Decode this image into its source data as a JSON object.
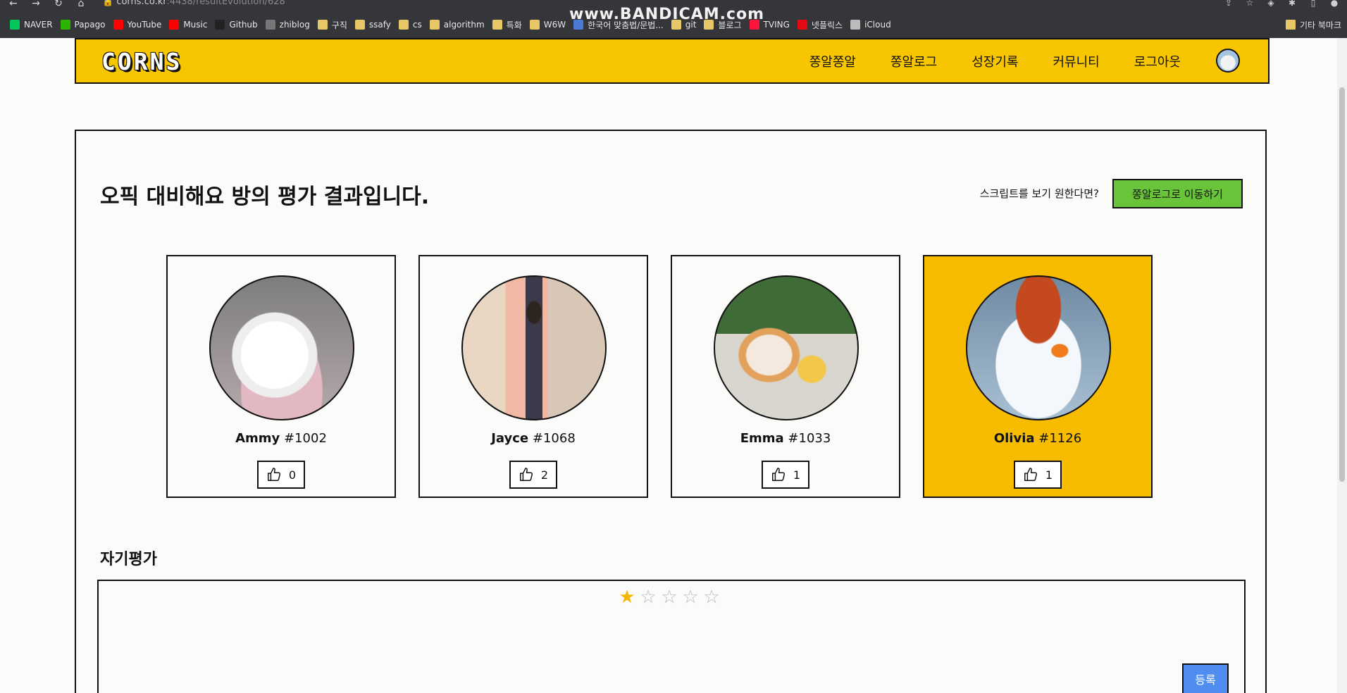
{
  "browser": {
    "url_host": "corns.co.kr",
    "url_rest": ":4438/resultEvolution/628",
    "watermark": "www.BANDICAM.com",
    "bookmarks": [
      {
        "label": "NAVER",
        "icon": "naver-icon",
        "color": "#03c75a"
      },
      {
        "label": "Papago",
        "icon": "papago-icon",
        "color": "#2db400"
      },
      {
        "label": "YouTube",
        "icon": "youtube-icon",
        "color": "#ff0000"
      },
      {
        "label": "Music",
        "icon": "music-icon",
        "color": "#ff0000"
      },
      {
        "label": "Github",
        "icon": "github-icon",
        "color": "#222222"
      },
      {
        "label": "zhiblog",
        "icon": "zhiblog-icon",
        "color": "#777777"
      },
      {
        "label": "구직",
        "icon": "folder-icon",
        "color": "#e8c766"
      },
      {
        "label": "ssafy",
        "icon": "folder-icon",
        "color": "#e8c766"
      },
      {
        "label": "cs",
        "icon": "folder-icon",
        "color": "#e8c766"
      },
      {
        "label": "algorithm",
        "icon": "folder-icon",
        "color": "#e8c766"
      },
      {
        "label": "특화",
        "icon": "folder-icon",
        "color": "#e8c766"
      },
      {
        "label": "W6W",
        "icon": "folder-icon",
        "color": "#e8c766"
      },
      {
        "label": "한국어 맞춤법/문법...",
        "icon": "spellcheck-icon",
        "color": "#4b7bd6"
      },
      {
        "label": "git",
        "icon": "folder-icon",
        "color": "#e8c766"
      },
      {
        "label": "블로그",
        "icon": "folder-icon",
        "color": "#e8c766"
      },
      {
        "label": "TVING",
        "icon": "tving-icon",
        "color": "#ff153c"
      },
      {
        "label": "넷플릭스",
        "icon": "netflix-icon",
        "color": "#e50914"
      },
      {
        "label": "iCloud",
        "icon": "apple-icon",
        "color": "#bbbbbb"
      }
    ],
    "other_bookmarks": "기타 북마크"
  },
  "header": {
    "logo": "CORNS",
    "nav": [
      "쫑알쫑알",
      "쫑알로그",
      "성장기록",
      "커뮤니티",
      "로그아웃"
    ],
    "accent_color": "#f7c600"
  },
  "main": {
    "title": "오픽 대비해요 방의 평가 결과입니다.",
    "script_question": "스크립트를 보기 원한다면?",
    "go_button": "쫑알로그로 이동하기",
    "go_button_color": "#6ac43a",
    "participants": [
      {
        "name": "Ammy",
        "id": "#1002",
        "likes": "0",
        "photo": "sleeping-white-dog",
        "selected": false
      },
      {
        "name": "Jayce",
        "id": "#1068",
        "likes": "2",
        "photo": "woman-in-closet",
        "selected": false
      },
      {
        "name": "Emma",
        "id": "#1033",
        "likes": "1",
        "photo": "cat-and-duckling",
        "selected": false
      },
      {
        "name": "Olivia",
        "id": "#1126",
        "likes": "1",
        "photo": "snowman-with-hat",
        "selected": true
      }
    ],
    "selected_color": "#f7bb00",
    "self_eval": {
      "title": "자기평가",
      "rating": 1,
      "max_rating": 5,
      "submit": "등록",
      "submit_color": "#4f8ef0"
    }
  }
}
